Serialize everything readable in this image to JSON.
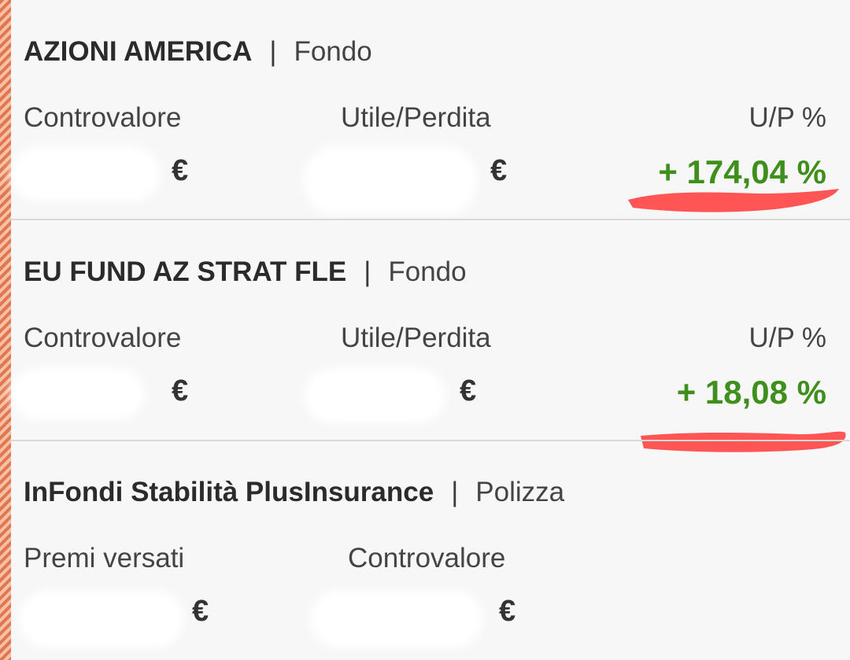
{
  "accent_bar_color": "#e2774f",
  "gain_color": "#3f8f1c",
  "markup_color": "#ff5555",
  "holdings": [
    {
      "name": "AZIONI AMERICA",
      "separator": "|",
      "kind": "Fondo",
      "col1_label": "Controvalore",
      "col1_value": "€",
      "col2_label": "Utile/Perdita",
      "col2_value": "€",
      "col3_label": "U/P %",
      "col3_value": "+ 174,04 %"
    },
    {
      "name": "EU FUND AZ STRAT FLE",
      "separator": "|",
      "kind": "Fondo",
      "col1_label": "Controvalore",
      "col1_value": "€",
      "col2_label": "Utile/Perdita",
      "col2_value": "€",
      "col3_label": "U/P %",
      "col3_value": "+ 18,08 %"
    },
    {
      "name": "InFondi Stabilità PlusInsurance",
      "separator": "|",
      "kind": "Polizza",
      "col1_label": "Premi versati",
      "col1_value": "€",
      "col2_label": "Controvalore",
      "col2_value": "€"
    }
  ]
}
